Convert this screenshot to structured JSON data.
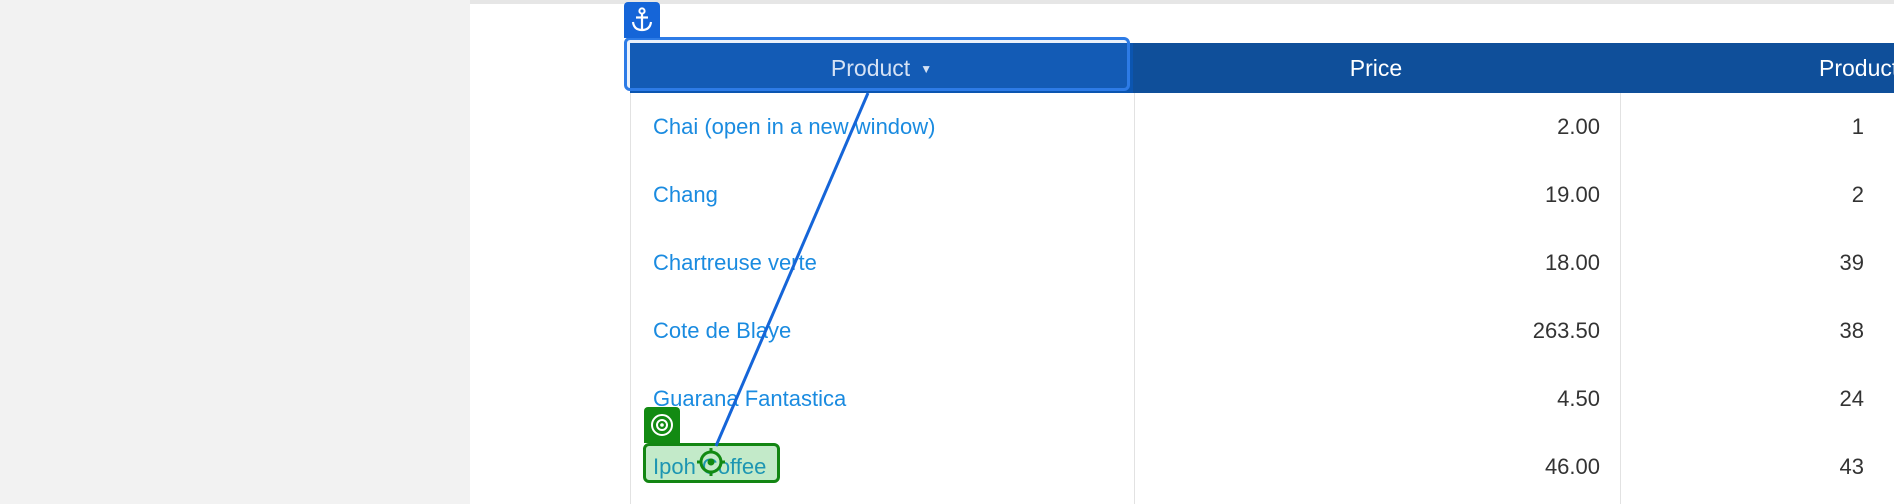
{
  "grid": {
    "columns": [
      {
        "label": "Product",
        "sort_indicator": "▼"
      },
      {
        "label": "Price"
      },
      {
        "label": "Product"
      }
    ],
    "rows": [
      {
        "product": "Chai  (open in a new window)",
        "price": "2.00",
        "product_id": "1"
      },
      {
        "product": "Chang",
        "price": "19.00",
        "product_id": "2"
      },
      {
        "product": "Chartreuse verte",
        "price": "18.00",
        "product_id": "39"
      },
      {
        "product": "Cote de Blaye",
        "price": "263.50",
        "product_id": "38"
      },
      {
        "product": "Guarana Fantastica",
        "price": "4.50",
        "product_id": "24"
      },
      {
        "product": "Ipoh Coffee",
        "price": "46.00",
        "product_id": "43"
      }
    ]
  },
  "overlay": {
    "anchor_icon": "anchor-icon",
    "target_icon": "target-icon",
    "crosshair_icon": "crosshair-icon",
    "colors": {
      "anchor": "#1565d8",
      "target": "#128a12",
      "header": "#0f4f9a",
      "link": "#1a8be0"
    }
  }
}
